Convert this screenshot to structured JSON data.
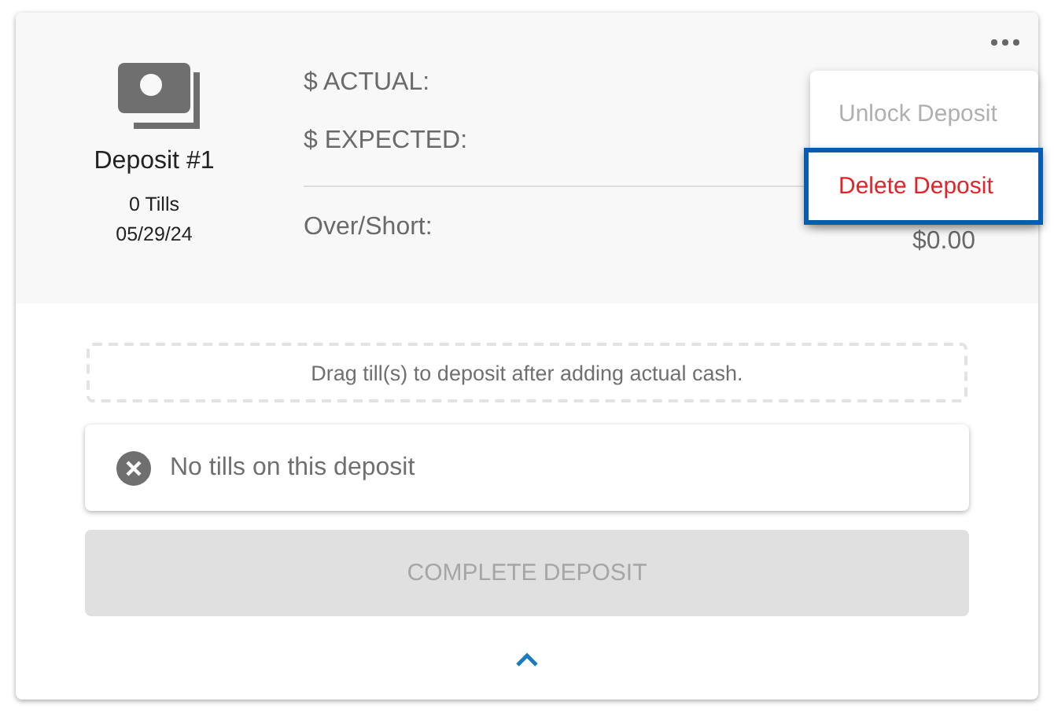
{
  "deposit": {
    "title": "Deposit #1",
    "tills": "0 Tills",
    "date": "05/29/24"
  },
  "totals": [
    {
      "label": "$ ACTUAL:"
    },
    {
      "label": "$ EXPECTED:"
    },
    {
      "label": "Over/Short:",
      "value": "$0.00"
    }
  ],
  "menu": {
    "items": [
      {
        "label": "Unlock Deposit",
        "kind": "normal",
        "disabled": true,
        "selected": false
      },
      {
        "label": "Delete Deposit",
        "kind": "danger",
        "disabled": false,
        "selected": true
      }
    ]
  },
  "drop_hint": "Drag till(s) to deposit after adding actual cash.",
  "empty_message": "No tills on this deposit",
  "complete_button": {
    "label": "COMPLETE DEPOSIT",
    "disabled": true
  }
}
